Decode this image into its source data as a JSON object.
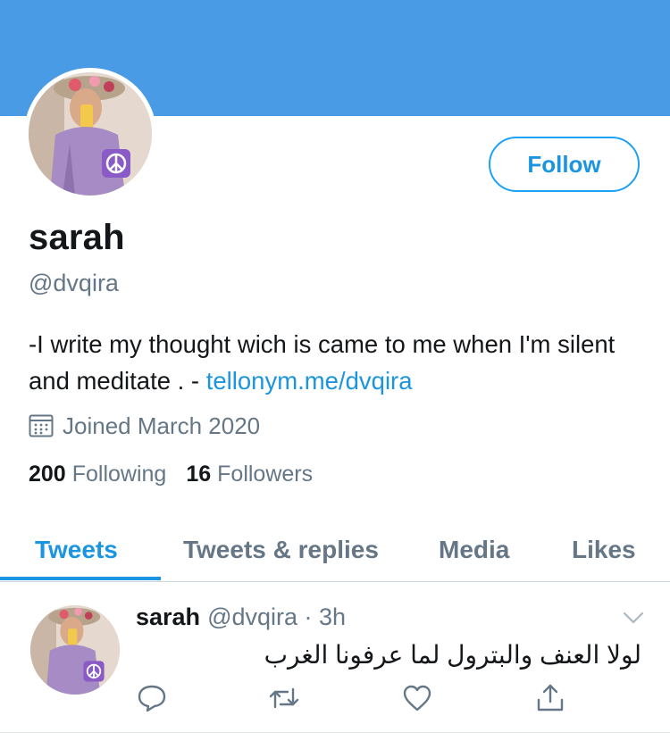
{
  "profile": {
    "name": "sarah",
    "handle": "@dvqira",
    "bio_text": "-I write my thought wich is came to me when I'm silent and meditate . - ",
    "bio_link": "tellonym.me/dvqira",
    "joined": "Joined March 2020",
    "following_count": "200",
    "following_label": "Following",
    "followers_count": "16",
    "followers_label": "Followers",
    "follow_button": "Follow",
    "banner_color": "#4a9be6",
    "accent_color": "#1b95e0",
    "avatar_badge_icon": "peace-icon"
  },
  "tabs": [
    {
      "label": "Tweets",
      "active": true
    },
    {
      "label": "Tweets & replies",
      "active": false
    },
    {
      "label": "Media",
      "active": false
    },
    {
      "label": "Likes",
      "active": false
    }
  ],
  "tweet": {
    "name": "sarah",
    "meta": "@dvqira · 3h",
    "text": "لولا العنف والبترول لما عرفونا الغرب",
    "actions": [
      "reply-icon",
      "retweet-icon",
      "like-icon",
      "share-icon"
    ]
  }
}
